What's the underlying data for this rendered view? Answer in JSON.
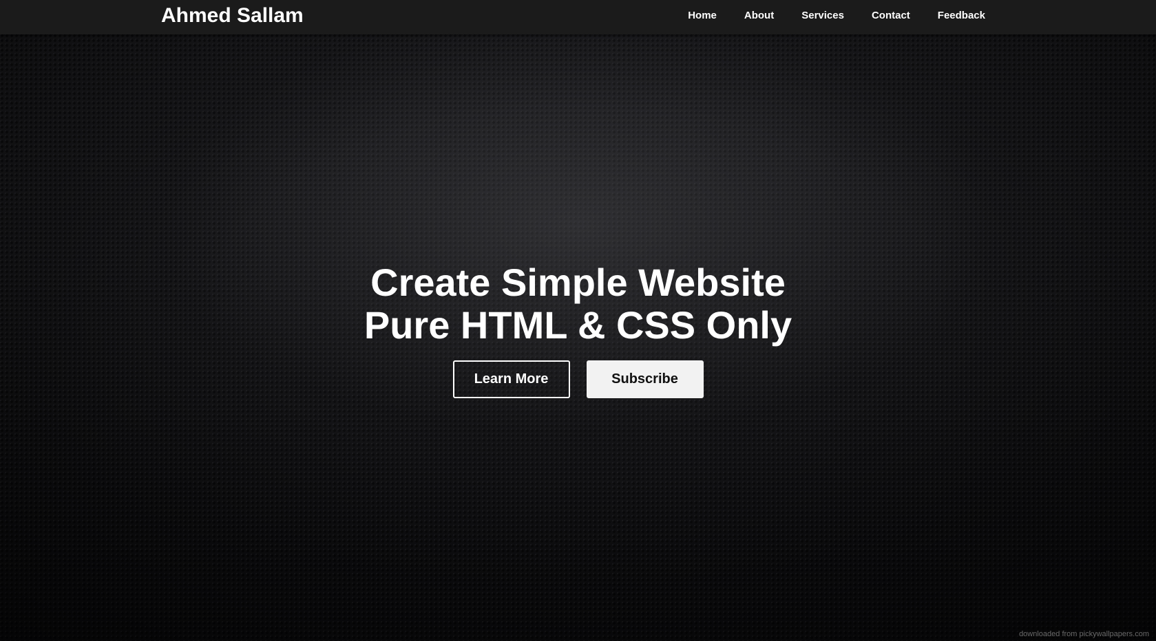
{
  "header": {
    "brand": "Ahmed Sallam",
    "nav": [
      {
        "label": "Home"
      },
      {
        "label": "About"
      },
      {
        "label": "Services"
      },
      {
        "label": "Contact"
      },
      {
        "label": "Feedback"
      }
    ]
  },
  "hero": {
    "title_line1": "Create Simple Website",
    "title_line2": "Pure HTML & CSS Only",
    "learn_more_label": "Learn More",
    "subscribe_label": "Subscribe"
  },
  "footer": {
    "watermark": "downloaded from pickywallpapers.com"
  },
  "colors": {
    "navbar": "#1b1b1b",
    "text": "#ffffff",
    "solid_button": "#f2f2f2"
  }
}
